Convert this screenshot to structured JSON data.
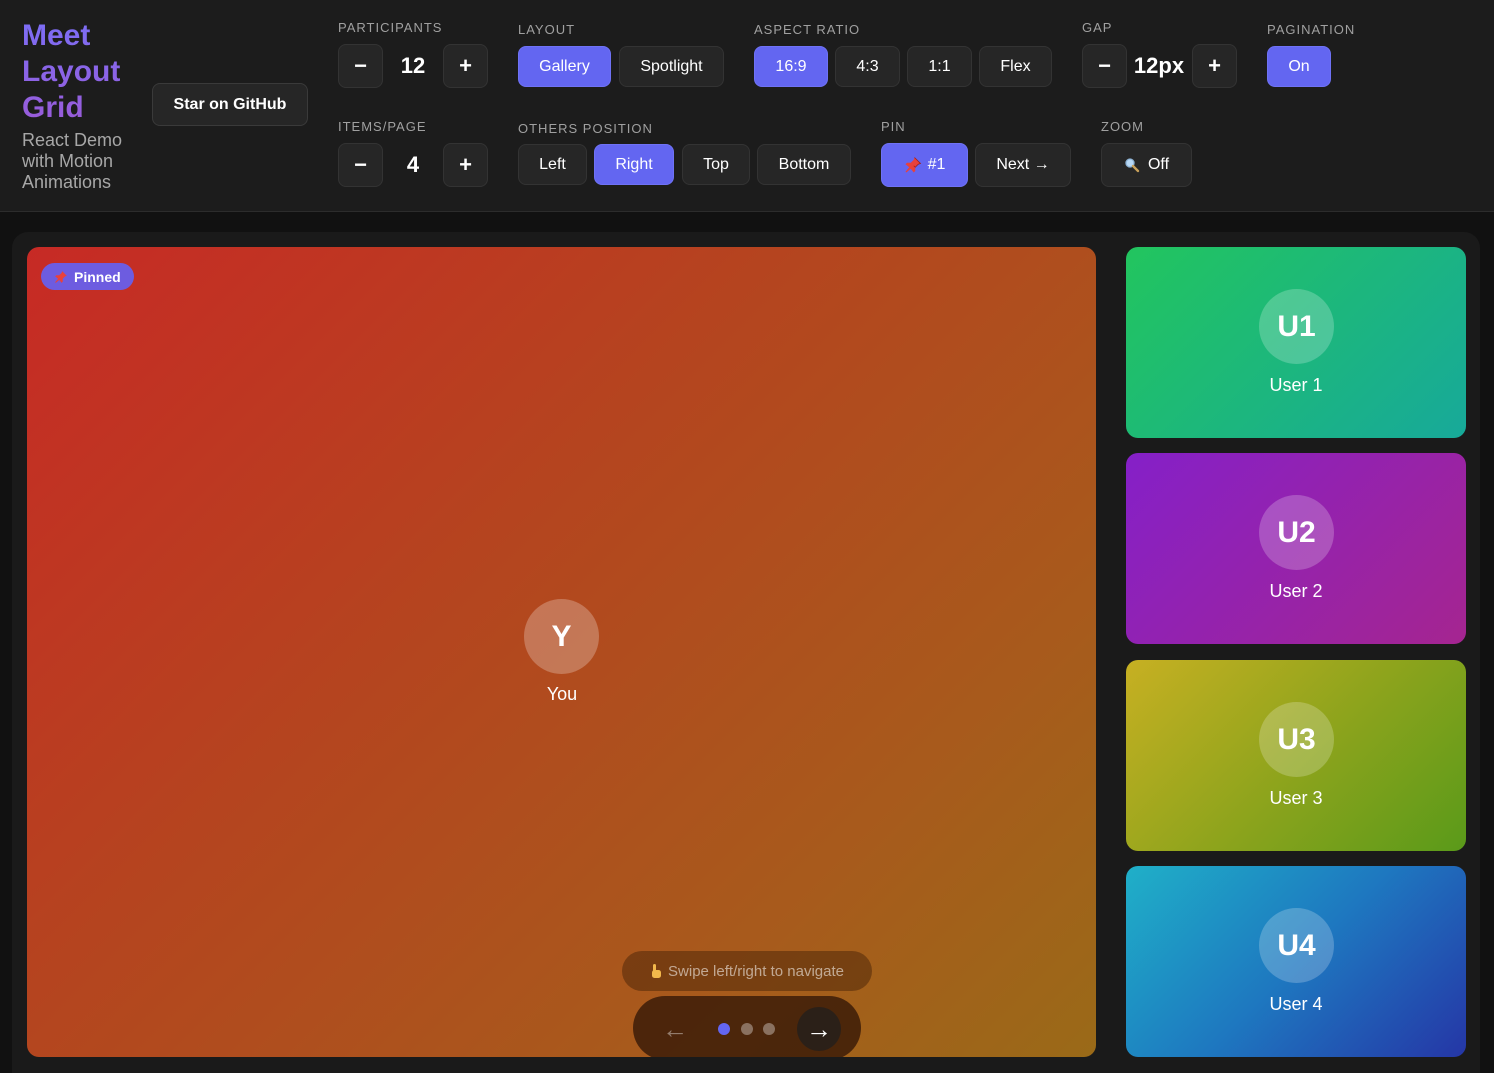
{
  "brand": {
    "title_line1": "Meet",
    "title_line2": "Layout",
    "title_line3": "Grid",
    "subtitle_line1": "React Demo",
    "subtitle_line2": "with Motion",
    "subtitle_line3": "Animations",
    "github_label": "Star on GitHub"
  },
  "controls": {
    "participants": {
      "label": "PARTICIPANTS",
      "value": "12",
      "minus": "−",
      "plus": "+"
    },
    "items_page": {
      "label": "ITEMS/PAGE",
      "value": "4",
      "minus": "−",
      "plus": "+"
    },
    "layout": {
      "label": "LAYOUT",
      "options": [
        "Gallery",
        "Spotlight"
      ],
      "selected": "Gallery"
    },
    "others_position": {
      "label": "OTHERS POSITION",
      "options": [
        "Left",
        "Right",
        "Top",
        "Bottom"
      ],
      "selected": "Right"
    },
    "aspect_ratio": {
      "label": "ASPECT RATIO",
      "options": [
        "16:9",
        "4:3",
        "1:1",
        "Flex"
      ],
      "selected": "16:9"
    },
    "pin": {
      "label": "PIN",
      "pin_value": "#1",
      "next_label": "Next →"
    },
    "gap": {
      "label": "GAP",
      "value": "12px",
      "minus": "−",
      "plus": "+"
    },
    "zoom": {
      "label": "ZOOM",
      "value": "Off"
    },
    "pagination": {
      "label": "PAGINATION",
      "value": "On"
    }
  },
  "main_tile": {
    "badge": "Pinned",
    "initial": "Y",
    "name": "You",
    "swipe_hint": "Swipe left/right to navigate",
    "pager": {
      "prev": "←",
      "next": "→",
      "pages": 3,
      "current": 1
    }
  },
  "side_tiles": [
    {
      "initial": "U1",
      "name": "User 1"
    },
    {
      "initial": "U2",
      "name": "User 2"
    },
    {
      "initial": "U3",
      "name": "User 3"
    },
    {
      "initial": "U4",
      "name": "User 4"
    }
  ],
  "colors": {
    "accent": "#6366f1",
    "tile_you": "#c72a25",
    "tile_user1": "#22c55e",
    "tile_user2": "#9333ea",
    "tile_user3": "#b8a81f",
    "tile_user4": "#1e90c8"
  }
}
